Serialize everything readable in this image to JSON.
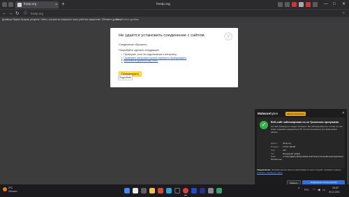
{
  "browser": {
    "tab_title": "freetp.org",
    "tab_close": "×",
    "new_tab": "+",
    "window_title": "freetp.org",
    "address": "freetp.org",
    "win_minimize": "—",
    "win_maximize": "□",
    "win_close": "✕"
  },
  "infobar": {
    "text": "Драйвера Яндекс.Браузер устарели. Сайты, которые вы запускали, могут работать медленнее. Обновите драйвер.",
    "link": "Как обновить драйвер"
  },
  "error_page": {
    "title": "Не удаётся установить соединение с сайтом.",
    "subtitle": "Соединение сброшено.",
    "try_heading": "Попробуйте сделать следующее:",
    "suggestions": [
      "Проверьте, есть ли подключение к интернету.",
      "Проверьте настройки прокси-сервера и брандмауэра.",
      "Выполните диагностику сети."
    ],
    "reload_label": "Перезагрузить",
    "details_label": "Подробнее"
  },
  "malwarebytes": {
    "brand_bold": "Malware",
    "brand_thin": "bytes",
    "badge": "Защита включена",
    "close": "✕",
    "heading": "Веб-сайт заблокирован из-за Троянская программа",
    "description": "Эту веб-страницу не следует посещать. Мы заблокировали ее, потому что она может содержать вредоносное ПО или использоваться для кражи ваших данных.",
    "fields": [
      {
        "key": "Домен:",
        "value": "freetp.org"
      },
      {
        "key": "IP-адрес:",
        "value": "172.67.150.98"
      },
      {
        "key": "Порт:",
        "value": "443"
      },
      {
        "key": "Тип:",
        "value": "Исходящий трафик"
      },
      {
        "key": "Файл:",
        "value": "C:\\Users\\Дмитрий\\AppData\\Local\\Yandex\\YandexBrowser\\Application\\browser.exe"
      }
    ],
    "note_prefix": "Уведомление:",
    "note_text": " Пробная версия защиты заканчивается через 14 дней. Сохраните защиту. ",
    "note_link": "Сравнить тарифные планы",
    "close_button": "Закрыть",
    "exclusion_button": "Управление исключениями"
  },
  "taskbar": {
    "weather_temp": "2°C",
    "weather_desc": "Облачно",
    "tray_up": "^",
    "tray_lang": "РУС",
    "tray_wifi": "◠",
    "tray_sound": "◀",
    "tray_battery": "▭",
    "clock_time": "13:47",
    "clock_date": "06.12.2021"
  }
}
